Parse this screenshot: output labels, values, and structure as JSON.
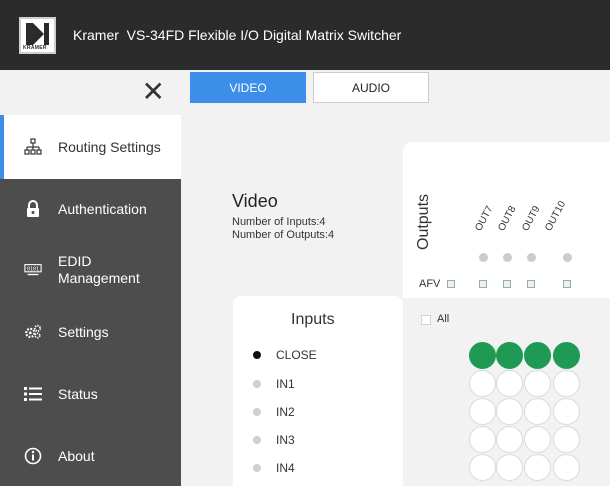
{
  "header": {
    "logo_text": "KRAMER",
    "title": "Kramer  VS-34FD Flexible I/O Digital Matrix Switcher",
    "bg_color": "#2b2b2b"
  },
  "sidebar": {
    "close_glyph": "✕",
    "items": [
      {
        "label": "Routing Settings",
        "icon": "sitemap-icon",
        "active": true
      },
      {
        "label": "Authentication",
        "icon": "lock-icon",
        "active": false
      },
      {
        "label_line1": "EDID",
        "label_line2": "Management",
        "icon": "edid-icon",
        "active": false
      },
      {
        "label": "Settings",
        "icon": "gears-icon",
        "active": false
      },
      {
        "label": "Status",
        "icon": "list-icon",
        "active": false
      },
      {
        "label": "About",
        "icon": "info-icon",
        "active": false
      }
    ]
  },
  "tabs": {
    "video": "VIDEO",
    "audio": "AUDIO",
    "active": "video",
    "accent_color": "#3d8ee8"
  },
  "video_info": {
    "heading": "Video",
    "inputs_text": "Number of Inputs:4",
    "outputs_text": "Number of Outputs:4"
  },
  "outputs": {
    "label": "Outputs",
    "afv_label": "AFV",
    "names": [
      "OUT7",
      "OUT8",
      "OUT9",
      "OUT10"
    ]
  },
  "inputs": {
    "title": "Inputs",
    "items": [
      {
        "label": "CLOSE",
        "selected": true
      },
      {
        "label": "IN1",
        "selected": false
      },
      {
        "label": "IN2",
        "selected": false
      },
      {
        "label": "IN3",
        "selected": false
      },
      {
        "label": "IN4",
        "selected": false
      }
    ]
  },
  "matrix": {
    "all_label": "All",
    "on_color": "#1f9a55",
    "rows": [
      [
        true,
        true,
        true,
        true
      ],
      [
        false,
        false,
        false,
        false
      ],
      [
        false,
        false,
        false,
        false
      ],
      [
        false,
        false,
        false,
        false
      ],
      [
        false,
        false,
        false,
        false
      ]
    ]
  }
}
